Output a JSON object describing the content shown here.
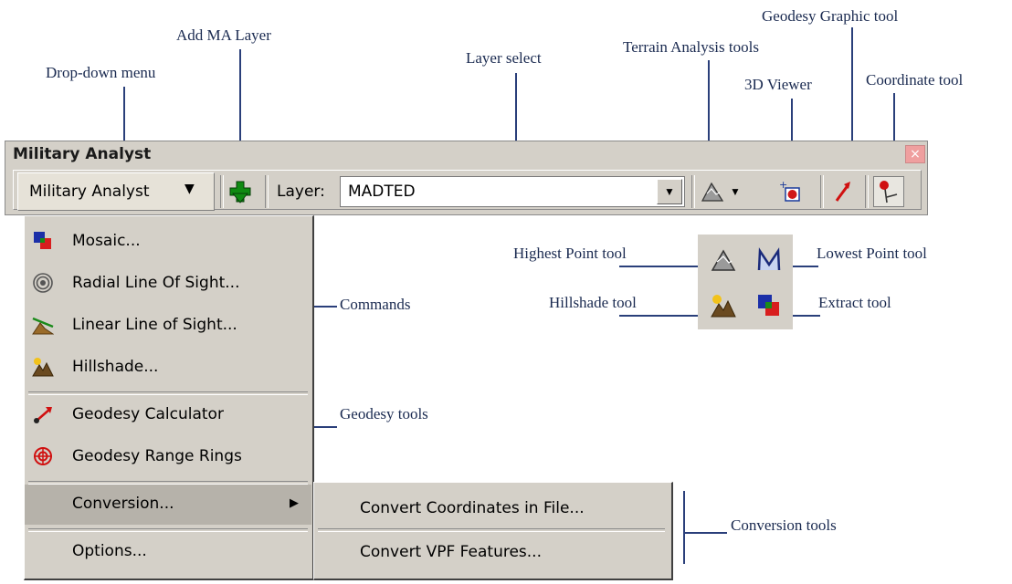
{
  "toolbar": {
    "title": "Military Analyst",
    "close_glyph": "×",
    "dropdown_label": "Military Analyst",
    "dropdown_arrow": "▼",
    "layer_label": "Layer:",
    "layer_value": "MADTED",
    "combo_arrow": "▼",
    "terrain_arrow": "▼"
  },
  "menu": {
    "items": [
      {
        "label": "Mosaic...",
        "icon": "mosaic-icon"
      },
      {
        "label": "Radial Line Of Sight...",
        "icon": "radial-los-icon"
      },
      {
        "label": "Linear Line of Sight...",
        "icon": "linear-los-icon"
      },
      {
        "label": "Hillshade...",
        "icon": "hillshade-icon"
      },
      {
        "label": "Geodesy Calculator",
        "icon": "geodesy-calculator-icon"
      },
      {
        "label": "Geodesy Range Rings",
        "icon": "range-rings-icon"
      },
      {
        "label": "Conversion...",
        "submenu_arrow": "▶"
      },
      {
        "label": "Options..."
      }
    ]
  },
  "submenu": {
    "items": [
      "Convert Coordinates in File...",
      "Convert VPF Features..."
    ]
  },
  "callouts": {
    "dropdown_menu": "Drop-down menu",
    "add_ma_layer": "Add MA Layer",
    "layer_select": "Layer select",
    "terrain_analysis": "Terrain Analysis tools",
    "viewer_3d": "3D Viewer",
    "geodesy_graphic": "Geodesy Graphic tool",
    "coordinate_tool": "Coordinate tool",
    "highest_point": "Highest Point tool",
    "lowest_point": "Lowest Point tool",
    "hillshade_tool": "Hillshade tool",
    "extract_tool": "Extract tool",
    "commands": "Commands",
    "geodesy_tools": "Geodesy tools",
    "conversion_tools": "Conversion tools"
  },
  "colors": {
    "callout_line": "#2a3f7a",
    "toolbar_bg": "#d4d0c8",
    "close_button": "#ef9f9f"
  }
}
